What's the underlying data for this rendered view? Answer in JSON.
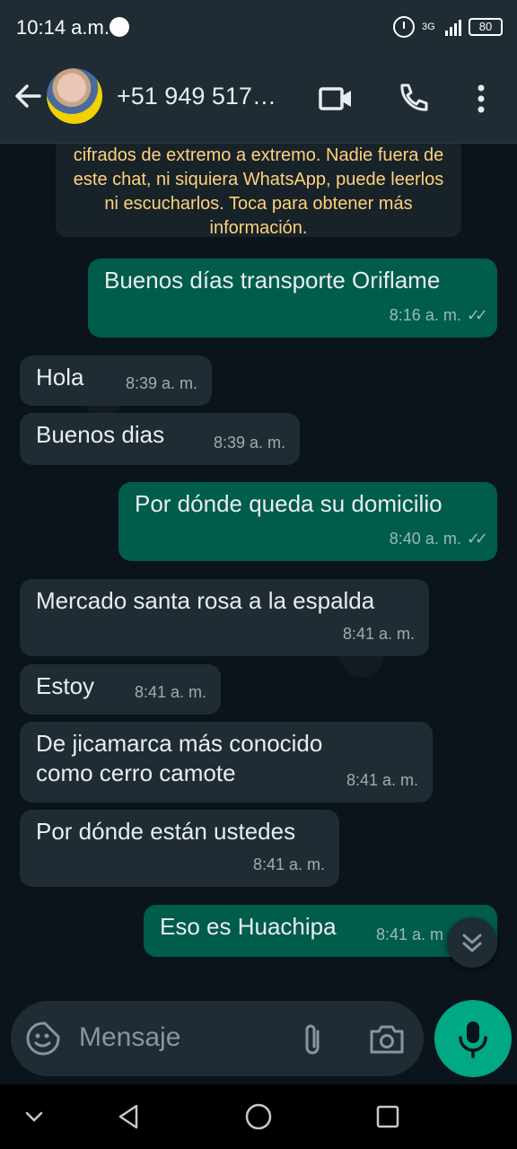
{
  "status_bar": {
    "time": "10:14 a.m.",
    "network": "3G",
    "battery": "80"
  },
  "header": {
    "contact_title": "+51 949 517…",
    "icons": [
      "back-arrow-icon",
      "video-call-icon",
      "phone-icon",
      "more-options-icon"
    ]
  },
  "encryption_notice": "cifrados de extremo a extremo. Nadie fuera de este chat, ni siquiera WhatsApp, puede leerlos ni escucharlos. Toca para obtener más información.",
  "messages": [
    {
      "dir": "out",
      "text": "Buenos días transporte Oriflame",
      "time": "8:16 a. m.",
      "read": true
    },
    {
      "dir": "in",
      "text": "Hola",
      "time": "8:39 a. m."
    },
    {
      "dir": "in",
      "text": "Buenos dias",
      "time": "8:39 a. m."
    },
    {
      "dir": "out",
      "text": "Por dónde queda su domicilio",
      "time": "8:40 a. m.",
      "read": true
    },
    {
      "dir": "in",
      "text": "Mercado santa rosa a la espalda",
      "time": "8:41 a. m."
    },
    {
      "dir": "in",
      "text": "Estoy",
      "time": "8:41 a. m."
    },
    {
      "dir": "in",
      "text": "De jicamarca más conocido como cerro camote",
      "time": "8:41 a. m."
    },
    {
      "dir": "in",
      "text": "Por dónde están ustedes",
      "time": "8:41 a. m."
    },
    {
      "dir": "out",
      "text": "Eso es Huachipa",
      "time": "8:41 a. m"
    }
  ],
  "composer": {
    "placeholder": "Mensaje"
  },
  "colors": {
    "background": "#0b141a",
    "incoming_bubble": "#1f2c34",
    "outgoing_bubble": "#005c4b",
    "accent": "#00a884",
    "notice_text": "#ffd279"
  }
}
